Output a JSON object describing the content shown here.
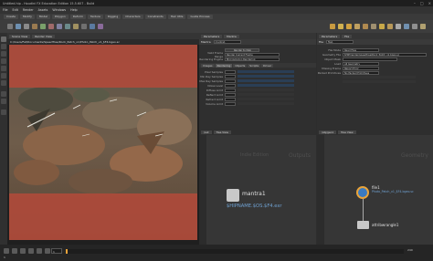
{
  "window": {
    "title": "Untitled.hip - Houdini FX Education Edition 15.5.607 - Build"
  },
  "menus": [
    "File",
    "Edit",
    "Render",
    "Assets",
    "Windows",
    "Help"
  ],
  "shelf_tabs": [
    "Create",
    "Modify",
    "Model",
    "Polygon",
    "Deform",
    "Texture",
    "Rigging",
    "Characters",
    "Constraints",
    "Hair Utils",
    "Guide Process"
  ],
  "viewport": {
    "tabs": [
      "Scene View",
      "Render View"
    ],
    "path": "C:/Users/Fat/Documents/SpeedTree/Rock_Patch_v1/Photo_Patch_v1_$F4.bgeo.sc"
  },
  "param_left": {
    "tabs": [
      "Parameters",
      "Mantra"
    ],
    "node_type": "Mantra",
    "node_name": "mantra1",
    "render_button": "Render to Disk",
    "rows": [
      {
        "label": "Valid Frame Range",
        "value": "Render Current Frame"
      },
      {
        "label": "Rendering Engine",
        "value": "Micropolygon Rendering"
      }
    ],
    "subtabs": [
      "Images",
      "Rendering",
      "Objects",
      "Scripts",
      "Driver"
    ],
    "sampling_rows": [
      "Pixel Samples",
      "Min Ray Samples",
      "Max Ray Samples",
      "Noise Level",
      "Diffuse Limit",
      "Reflect Limit",
      "Refract Limit",
      "Volume Limit"
    ]
  },
  "param_right": {
    "tabs": [
      "Parameters",
      "File"
    ],
    "node_type": "File",
    "node_name": "file1",
    "rows": [
      {
        "label": "File Mode",
        "value": "Read Files"
      },
      {
        "label": "Geometry File",
        "value": "$HIP/render/speedtree/Rock_Patch_v1.bgeo.sc"
      },
      {
        "label": "Object Mask",
        "value": ""
      },
      {
        "label": "Load",
        "value": "All Geometry"
      },
      {
        "label": "Missing Frame",
        "value": "Report Error"
      },
      {
        "label": "Packed Primitives",
        "value": "No Packed Primitives"
      }
    ]
  },
  "net_left": {
    "tabs": [
      "/out",
      "Tree View"
    ],
    "watermark_left": "Indie Edition",
    "watermark_right": "Outputs",
    "node_label": "mantra1",
    "node_sub": "$HIPNAME.$OS.$F4.exr"
  },
  "net_right": {
    "tabs": [
      "/obj/geo1",
      "Tree View"
    ],
    "watermark": "Geometry",
    "file_node": "file1",
    "file_sub": "Photo_Patch_v1_$F4.bgeo.sc",
    "attrib_node": "attribwrangle1"
  },
  "timeline": {
    "current_frame": "1",
    "start": "1",
    "end": "240"
  },
  "colors": {
    "accent": "#e8a33a",
    "red_overlay": "#b24a3a",
    "node_link": "#6fa0d0"
  }
}
